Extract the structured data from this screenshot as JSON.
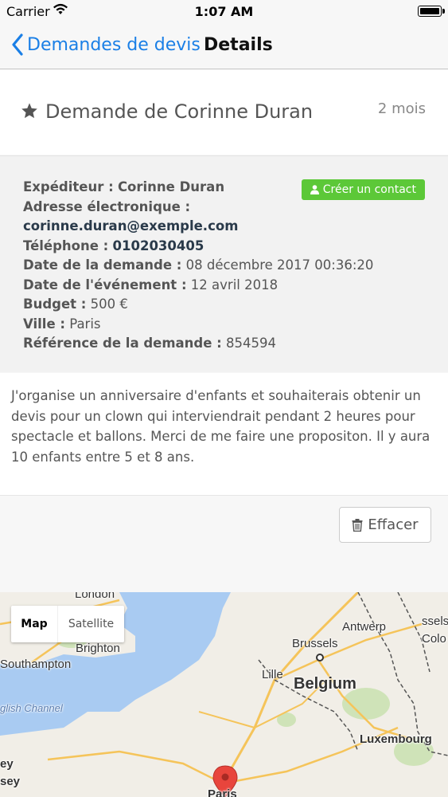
{
  "status": {
    "carrier": "Carrier",
    "time": "1:07 AM"
  },
  "nav": {
    "back_label": "Demandes de devis",
    "title": "Details"
  },
  "header": {
    "name": "Demande de Corinne Duran",
    "ago": "2 mois"
  },
  "info": {
    "contact_button": "Créer un contact",
    "sender_label": "Expéditeur :",
    "sender_value": "Corinne Duran",
    "email_label": "Adresse électronique :",
    "email_value": "corinne.duran@exemple.com",
    "phone_label": "Téléphone :",
    "phone_value": "0102030405",
    "request_date_label": "Date de la demande :",
    "request_date_value": "08 décembre 2017 00:36:20",
    "event_date_label": "Date de l'événement :",
    "event_date_value": "12 avril 2018",
    "budget_label": "Budget :",
    "budget_value": "500 €",
    "city_label": "Ville :",
    "city_value": "Paris",
    "reference_label": "Référence de la demande :",
    "reference_value": "854594"
  },
  "message": "J'organise un anniversaire d'enfants et souhaiterais obtenir un devis pour un clown qui interviendrait pendant 2 heures pour spectacle et ballons. Merci de me faire une propositon. Il y aura 10 enfants entre 5 et 8 ans.",
  "delete_button": "Effacer",
  "map": {
    "toggle_map": "Map",
    "toggle_satellite": "Satellite",
    "labels": {
      "london": "London",
      "brighton": "Brighton",
      "southampton": "Southampton",
      "channel": "glish Channel",
      "brussels": "Brussels",
      "antwerp": "Antwerp",
      "lille": "Lille",
      "belgium": "Belgium",
      "luxembourg": "Luxembourg",
      "cologne": "Colo",
      "bruxelles_short": "ssels",
      "ey": "ey",
      "sey": "sey",
      "paris": "Paris"
    },
    "colors": {
      "sea": "#a9cbf2",
      "land": "#f1eee7",
      "pin": "#e8453c",
      "road": "#f5c45a"
    }
  }
}
